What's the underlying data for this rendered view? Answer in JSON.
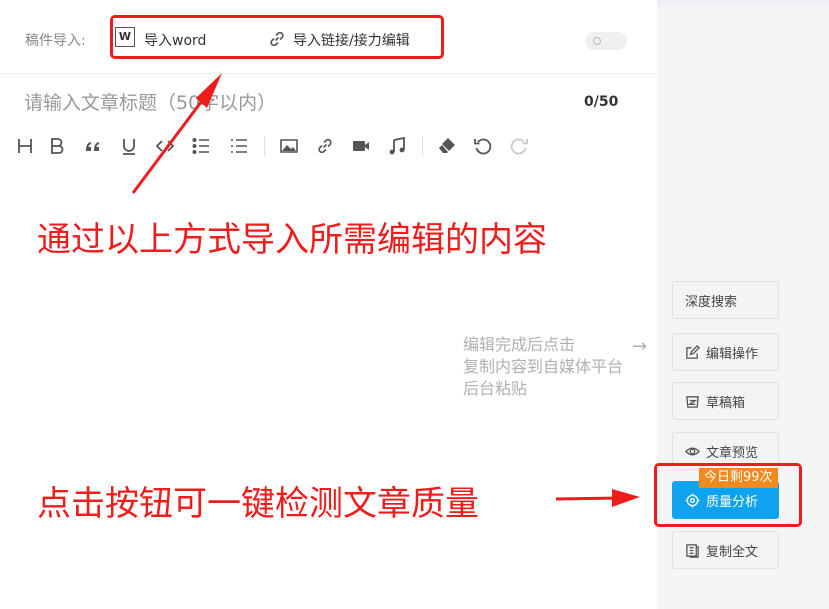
{
  "import": {
    "label": "稿件导入:",
    "word_icon": "W",
    "word": "导入word",
    "link": "导入链接/接力编辑"
  },
  "title": {
    "placeholder": "请输入文章标题（50字以内）",
    "count": "0/50"
  },
  "toolbar": [
    "heading-icon",
    "bold-icon",
    "quote-icon",
    "underline-icon",
    "code-icon",
    "ordered-list-icon",
    "unordered-list-icon",
    "image-icon",
    "link-icon",
    "video-icon",
    "music-icon",
    "clear-format-icon",
    "undo-icon",
    "redo-icon"
  ],
  "annotations": {
    "import_hint": "通过以上方式导入所需编辑的内容",
    "quality_hint": "点击按钮可一键检测文章质量"
  },
  "hint": {
    "line1": "编辑完成后点击",
    "line2": "复制内容到自媒体平台",
    "line3": "后台粘贴"
  },
  "sidebar": {
    "deep_search": "深度搜索",
    "edit_ops": "编辑操作",
    "drafts": "草稿箱",
    "preview": "文章预览",
    "quality": "质量分析",
    "quality_badge": "今日剩99次",
    "copy_all": "复制全文"
  },
  "colors": {
    "annotation_red": "#ef1c1c",
    "primary_blue": "#0fa3ef",
    "badge_orange": "#f28a1b"
  }
}
